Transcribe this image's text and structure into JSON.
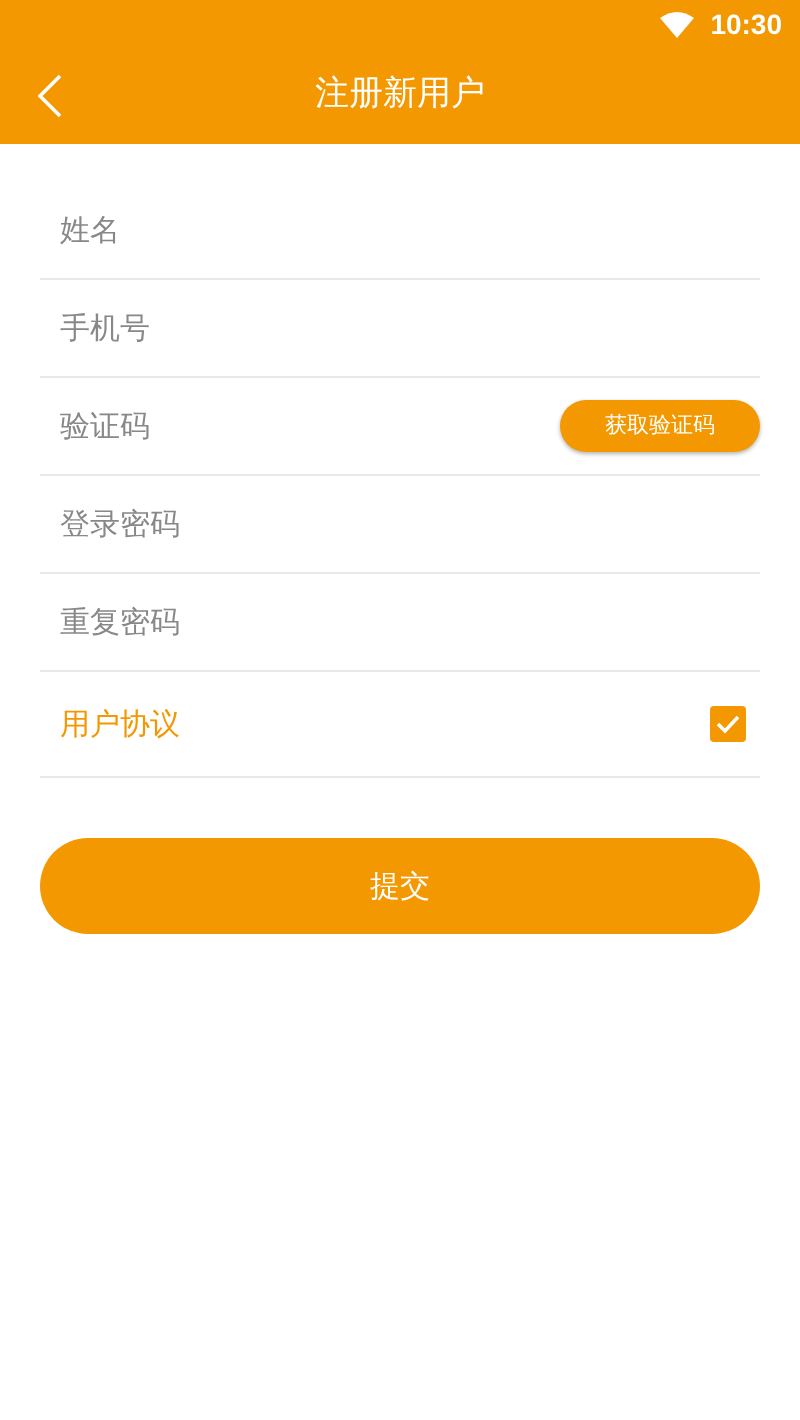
{
  "status_bar": {
    "time": "10:30"
  },
  "header": {
    "title": "注册新用户"
  },
  "fields": [
    {
      "placeholder": "姓名",
      "kind": "text"
    },
    {
      "placeholder": "手机号",
      "kind": "text"
    },
    {
      "placeholder": "验证码",
      "kind": "code",
      "button": "获取验证码"
    },
    {
      "placeholder": "登录密码",
      "kind": "password"
    },
    {
      "placeholder": "重复密码",
      "kind": "password"
    }
  ],
  "agreement": {
    "label": "用户协议",
    "checked": true
  },
  "submit": "提交"
}
